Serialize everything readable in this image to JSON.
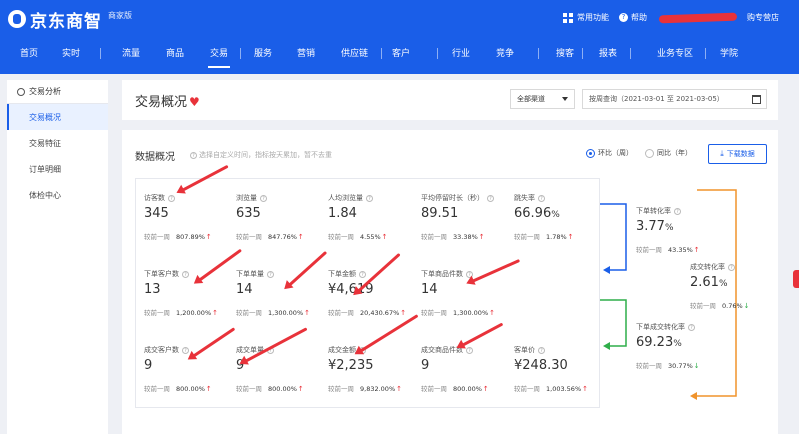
{
  "brand": {
    "name": "京东商智",
    "edition": "商家版"
  },
  "top_links": {
    "apps": "常用功能",
    "help": "帮助",
    "shop": "购专营店"
  },
  "nav": [
    "首页",
    "实时",
    "流量",
    "商品",
    "交易",
    "服务",
    "营销",
    "供应链",
    "客户",
    "行业",
    "竞争",
    "搜客",
    "报表",
    "业务专区",
    "学院"
  ],
  "nav_active_index": 4,
  "sidebar": {
    "header": "交易分析",
    "items": [
      {
        "label": "交易概况",
        "active": true
      },
      {
        "label": "交易特征",
        "active": false
      },
      {
        "label": "订单明细",
        "active": false
      },
      {
        "label": "体检中心",
        "active": false
      }
    ]
  },
  "page": {
    "title": "交易概况",
    "channel_select": "全部渠道",
    "date_range": "按周查询（2021-03-01 至 2021-03-05）"
  },
  "overview": {
    "title": "数据概况",
    "hint": "选择自定义时间，指标按天累加，暂不去重",
    "compare_wow": "环比（周）",
    "compare_yoy": "同比（年）",
    "download": "下载数据",
    "compare_prefix": "较前一周",
    "metrics": [
      {
        "label": "访客数",
        "value": "345",
        "change": "807.89%",
        "dir": "up"
      },
      {
        "label": "浏览量",
        "value": "635",
        "change": "847.76%",
        "dir": "up"
      },
      {
        "label": "人均浏览量",
        "value": "1.84",
        "change": "4.55%",
        "dir": "up"
      },
      {
        "label": "平均停留时长（秒）",
        "value": "89.51",
        "change": "33.38%",
        "dir": "up"
      },
      {
        "label": "跳失率",
        "value": "66.96",
        "unit": "%",
        "change": "1.78%",
        "dir": "up"
      },
      {
        "label": "下单客户数",
        "value": "13",
        "change": "1,200.00%",
        "dir": "up"
      },
      {
        "label": "下单单量",
        "value": "14",
        "change": "1,300.00%",
        "dir": "up"
      },
      {
        "label": "下单金额",
        "value": "¥4,619",
        "change": "20,430.67%",
        "dir": "up"
      },
      {
        "label": "下单商品件数",
        "value": "14",
        "change": "1,300.00%",
        "dir": "up"
      },
      {
        "label": "成交客户数",
        "value": "9",
        "change": "800.00%",
        "dir": "up"
      },
      {
        "label": "成交单量",
        "value": "9",
        "change": "800.00%",
        "dir": "up"
      },
      {
        "label": "成交金额",
        "value": "¥2,235",
        "change": "9,832.00%",
        "dir": "up"
      },
      {
        "label": "成交商品件数",
        "value": "9",
        "change": "800.00%",
        "dir": "up"
      },
      {
        "label": "客单价",
        "value": "¥248.30",
        "change": "1,003.56%",
        "dir": "up"
      }
    ],
    "funnel": [
      {
        "label": "下单转化率",
        "value": "3.77",
        "unit": "%",
        "change": "43.35%",
        "dir": "up"
      },
      {
        "label": "成交转化率",
        "value": "2.61",
        "unit": "%",
        "change": "0.76%",
        "dir": "down"
      },
      {
        "label": "下单成交转化率",
        "value": "69.23",
        "unit": "%",
        "change": "30.77%",
        "dir": "down"
      }
    ]
  },
  "colors": {
    "brand_blue": "#1a5ee8",
    "up_red": "#e8323a",
    "down_green": "#2fae4a",
    "funnel_blue": "#1a5ee8",
    "funnel_green": "#2fae4a",
    "funnel_orange": "#f0932b"
  }
}
